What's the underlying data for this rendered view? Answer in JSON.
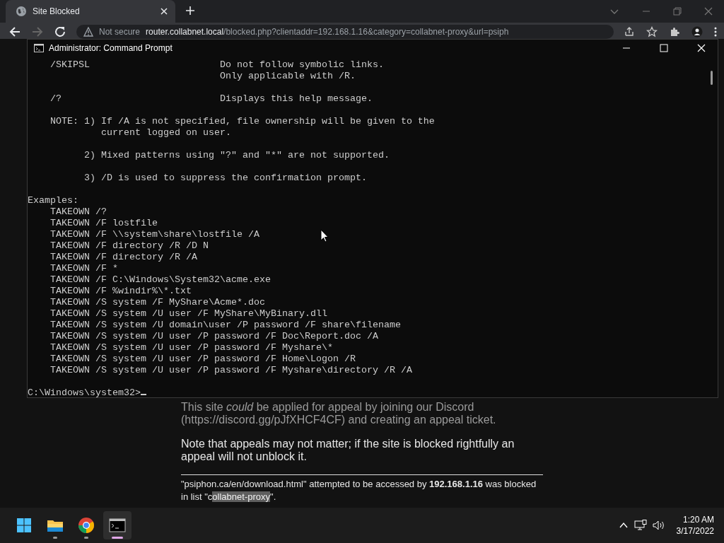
{
  "browser": {
    "tabs": [
      {
        "title": "Site Blocked",
        "selected": true
      }
    ],
    "address": {
      "security": "Not secure",
      "url_host": "router.collabnet.local",
      "url_path": "/blocked.php?clientaddr=192.168.1.16&category=collabnet-proxy&url=psiph"
    }
  },
  "page": {
    "appeal_text": "This site *could* be applied for appeal by joining our Discord (https://discord.gg/pJfXHCF4CF) and creating an appeal ticket.",
    "note_text": "Note that appeals may not matter; if the site is blocked rightfully an appeal will not unblock it.",
    "block_info": {
      "text": "\"psiphon.ca/en/download.html\" attempted to be accessed by **192.168.1.16** was blocked in list \"c",
      "highlighted": "ollabnet-proxy",
      "tail": "\"."
    }
  },
  "console": {
    "title": "Administrator: Command Prompt",
    "blocks": [
      [
        "    /SKIPSL                       Do not follow symbolic links.",
        "                                  Only applicable with /R."
      ],
      [
        "    /?                            Displays this help message."
      ],
      [
        "    NOTE: 1) If /A is not specified, file ownership will be given to the",
        "             current logged on user."
      ],
      [
        "          2) Mixed patterns using \"?\" and \"*\" are not supported."
      ],
      [
        "          3) /D is used to suppress the confirmation prompt."
      ],
      [
        "Examples:",
        "    TAKEOWN /?",
        "    TAKEOWN /F lostfile",
        "    TAKEOWN /F \\\\system\\share\\lostfile /A",
        "    TAKEOWN /F directory /R /D N",
        "    TAKEOWN /F directory /R /A",
        "    TAKEOWN /F *",
        "    TAKEOWN /F C:\\Windows\\System32\\acme.exe",
        "    TAKEOWN /F %windir%\\*.txt",
        "    TAKEOWN /S system /F MyShare\\Acme*.doc",
        "    TAKEOWN /S system /U user /F MyShare\\MyBinary.dll",
        "    TAKEOWN /S system /U domain\\user /P password /F share\\filename",
        "    TAKEOWN /S system /U user /P password /F Doc\\Report.doc /A",
        "    TAKEOWN /S system /U user /P password /F Myshare\\*",
        "    TAKEOWN /S system /U user /P password /F Home\\Logon /R",
        "    TAKEOWN /S system /U user /P password /F Myshare\\directory /R /A"
      ]
    ],
    "prompt": "C:\\Windows\\system32>"
  },
  "taskbar": {
    "apps": [
      {
        "kind": "start",
        "running": false,
        "selected": false
      },
      {
        "kind": "explorer",
        "running": true,
        "selected": false
      },
      {
        "kind": "chrome",
        "running": true,
        "selected": false
      },
      {
        "kind": "terminal",
        "running": true,
        "selected": true
      }
    ],
    "time": "1:20 AM",
    "date": "3/17/2022"
  }
}
